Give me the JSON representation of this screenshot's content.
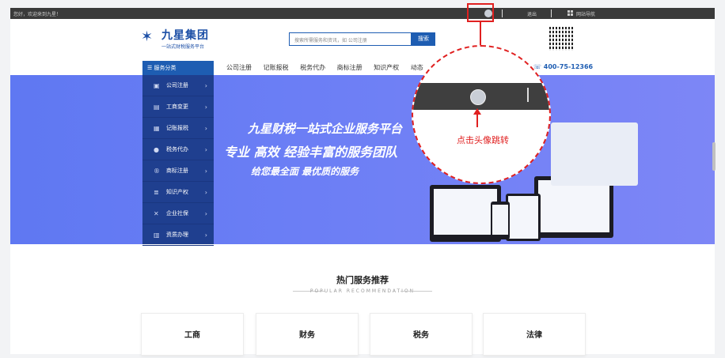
{
  "topbar": {
    "greeting": "您好，欢迎来到九星！",
    "logout": "退出",
    "site_nav": "网站导航"
  },
  "header": {
    "logo_name": "九星集团",
    "logo_slogan": "一站式财税服务平台",
    "search_placeholder": "搜索所需服务和资讯，如 公司注册",
    "search_button": "搜索",
    "phone": "400-75-12366"
  },
  "nav": {
    "category_label": "服务分类",
    "links": [
      "公司注册",
      "记账报税",
      "税务代办",
      "商标注册",
      "知识产权",
      "动态"
    ]
  },
  "sidebar": {
    "items": [
      "公司注册",
      "工商变更",
      "记账报税",
      "税务代办",
      "商标注册",
      "知识产权",
      "企业社保",
      "资质办理"
    ]
  },
  "banner": {
    "title": "九星财税一站式企业服务平台",
    "subtitle": "专业  高效  经验丰富的服务团队",
    "tagline": "给您最全面 最优质的服务"
  },
  "recommend": {
    "title": "热门服务推荐",
    "subtitle": "POPULAR RECOMMENDATION",
    "cards": [
      "工商",
      "财务",
      "税务",
      "法律"
    ]
  },
  "annotation": {
    "callout": "点击头像跳转",
    "highlight_color": "#e02020"
  }
}
